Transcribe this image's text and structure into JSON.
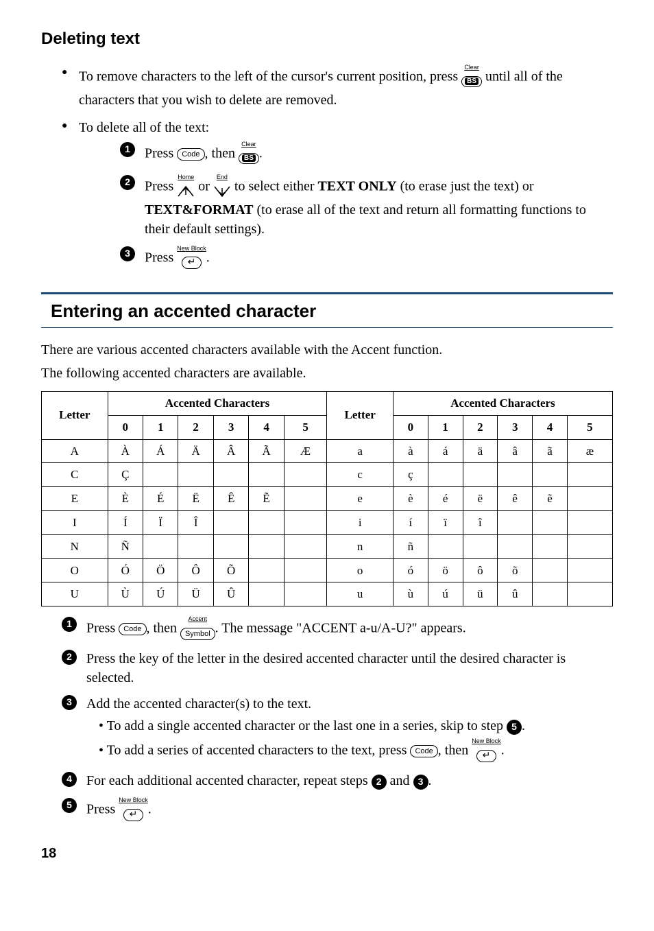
{
  "deleting": {
    "title": "Deleting text",
    "remove_chars": "To remove characters to the left of the cursor's current position, press ",
    "remove_chars_tail": " until all of the characters that you wish to delete are removed.",
    "delete_all_intro": "To delete all of the text:",
    "step1_a": "Press ",
    "step1_b": ", then ",
    "step1_c": ".",
    "step2_a": "Press ",
    "step2_b": " or ",
    "step2_c": " to select either ",
    "step2_textonly": "TEXT ONLY",
    "step2_d": " (to erase just the text) or ",
    "step2_textformat": "TEXT&FORMAT",
    "step2_e": " (to erase all of the text and return all formatting functions to their default settings).",
    "step3_a": "Press ",
    "step3_b": "."
  },
  "keys": {
    "code": "Code",
    "bs": "BS",
    "clear": "Clear",
    "home": "Home",
    "end": "End",
    "newblock": "New Block",
    "accent": "Accent",
    "symbol": "Symbol"
  },
  "accented": {
    "title": "Entering an accented character",
    "intro1": "There are various accented characters available with the Accent function.",
    "intro2": "The following accented characters are available.",
    "th_letter": "Letter",
    "th_accented": "Accented Characters",
    "cols": [
      "0",
      "1",
      "2",
      "3",
      "4",
      "5"
    ],
    "step1_a": "Press ",
    "step1_b": ", then ",
    "step1_c": ". The message \"ACCENT a-u/A-U?\" appears.",
    "step2": "Press the key of the letter in the desired accented character until the desired character is selected.",
    "step3_lead": "Add the accented character(s) to the text.",
    "step3_sub1_a": "To add a single accented character or the last one in a series, skip to step ",
    "step3_sub1_b": ".",
    "step3_sub2_a": "To add a series of accented characters to the text, press ",
    "step3_sub2_b": ", then ",
    "step3_sub2_c": ".",
    "step4_a": "For each additional accented character, repeat steps ",
    "step4_b": " and ",
    "step4_c": ".",
    "step5_a": "Press ",
    "step5_b": "."
  },
  "chart_data": {
    "type": "table",
    "title": "Accented Characters",
    "columns_left": [
      "Letter",
      "0",
      "1",
      "2",
      "3",
      "4",
      "5"
    ],
    "columns_right": [
      "Letter",
      "0",
      "1",
      "2",
      "3",
      "4",
      "5"
    ],
    "rows": [
      {
        "left": [
          "A",
          "À",
          "Á",
          "Ä",
          "Â",
          "Ã",
          "Æ"
        ],
        "right": [
          "a",
          "à",
          "á",
          "ä",
          "â",
          "ã",
          "æ"
        ]
      },
      {
        "left": [
          "C",
          "Ç",
          "",
          "",
          "",
          "",
          ""
        ],
        "right": [
          "c",
          "ç",
          "",
          "",
          "",
          "",
          ""
        ]
      },
      {
        "left": [
          "E",
          "È",
          "É",
          "Ë",
          "Ê",
          "Ẽ",
          ""
        ],
        "right": [
          "e",
          "è",
          "é",
          "ë",
          "ê",
          "ẽ",
          ""
        ]
      },
      {
        "left": [
          "I",
          "Í",
          "Ï",
          "Î",
          "",
          "",
          ""
        ],
        "right": [
          "i",
          "í",
          "ï",
          "î",
          "",
          "",
          ""
        ]
      },
      {
        "left": [
          "N",
          "Ñ",
          "",
          "",
          "",
          "",
          ""
        ],
        "right": [
          "n",
          "ñ",
          "",
          "",
          "",
          "",
          ""
        ]
      },
      {
        "left": [
          "O",
          "Ó",
          "Ö",
          "Ô",
          "Õ",
          "",
          ""
        ],
        "right": [
          "o",
          "ó",
          "ö",
          "ô",
          "õ",
          "",
          ""
        ]
      },
      {
        "left": [
          "U",
          "Ù",
          "Ú",
          "Ü",
          "Û",
          "",
          ""
        ],
        "right": [
          "u",
          "ù",
          "ú",
          "ü",
          "û",
          "",
          ""
        ]
      }
    ]
  },
  "page_number": "18"
}
